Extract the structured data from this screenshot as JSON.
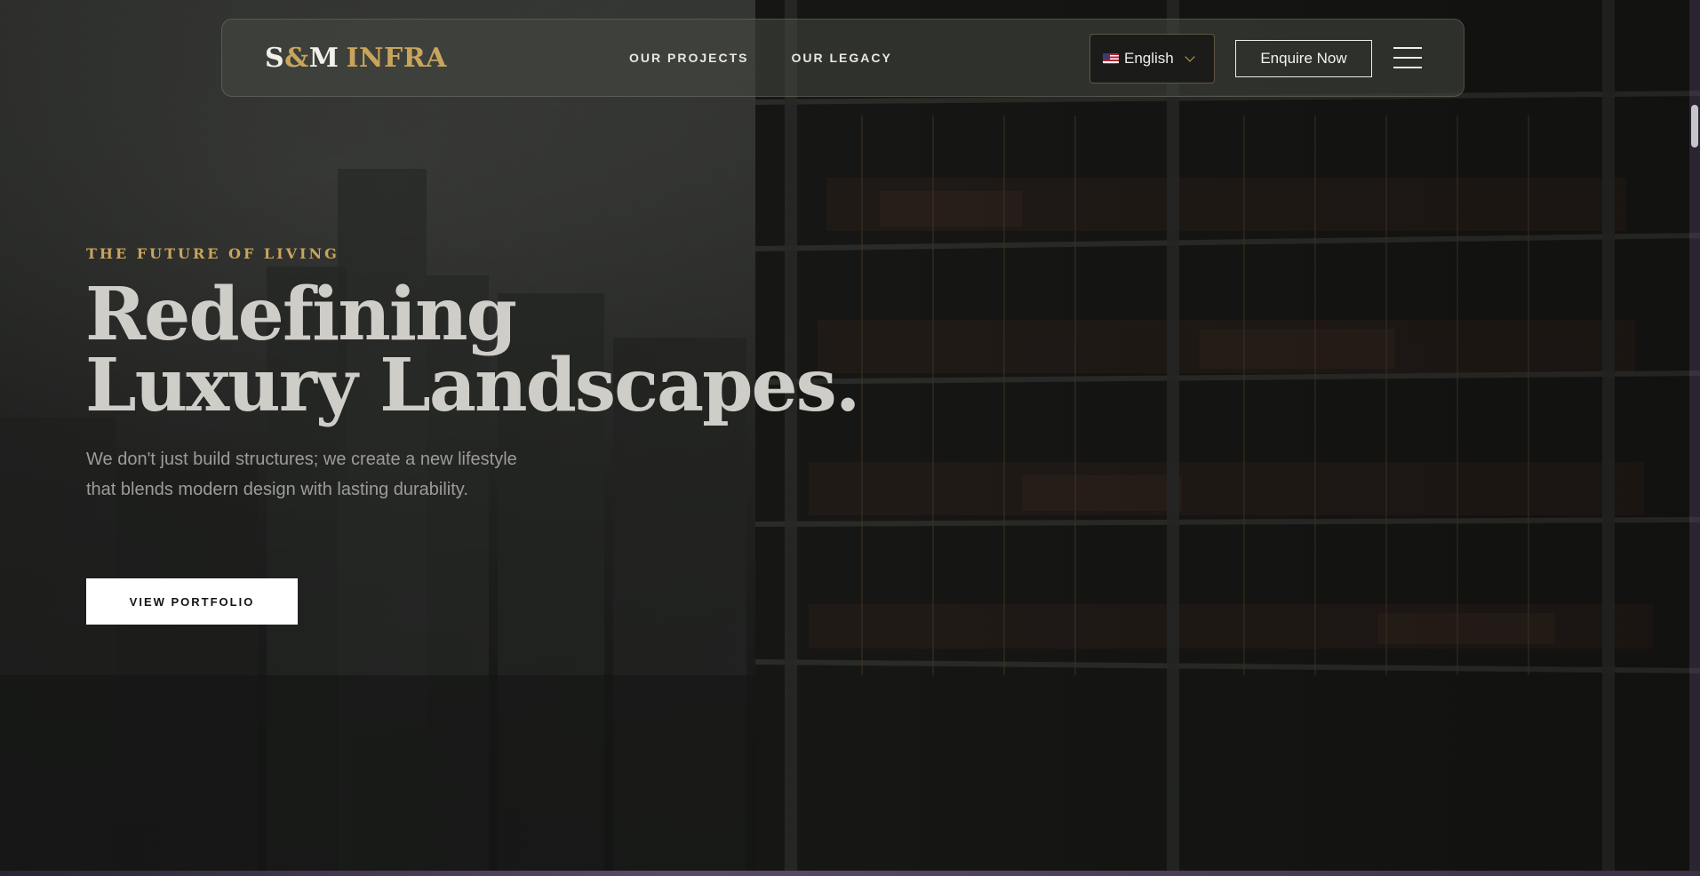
{
  "brand": {
    "logo_prefix": "S",
    "logo_amp": "&",
    "logo_m": "M",
    "logo_suffix": "INFRA"
  },
  "nav": {
    "links": [
      {
        "label": "OUR PROJECTS"
      },
      {
        "label": "OUR LEGACY"
      }
    ],
    "language": {
      "selected": "English",
      "flag": "us-flag-icon"
    },
    "enquire_label": "Enquire Now",
    "menu_icon": "hamburger-menu-icon"
  },
  "hero": {
    "eyebrow": "THE FUTURE OF LIVING",
    "headline_line1": "Redefining",
    "headline_line2": "Luxury Landscapes.",
    "subcopy": "We don't just build structures; we create a new lifestyle that blends modern design with lasting durability.",
    "cta_label": "VIEW PORTFOLIO"
  },
  "colors": {
    "accent_gold": "#c9a45c",
    "text_light": "#efede8",
    "background_dark": "#1a1b1a"
  }
}
